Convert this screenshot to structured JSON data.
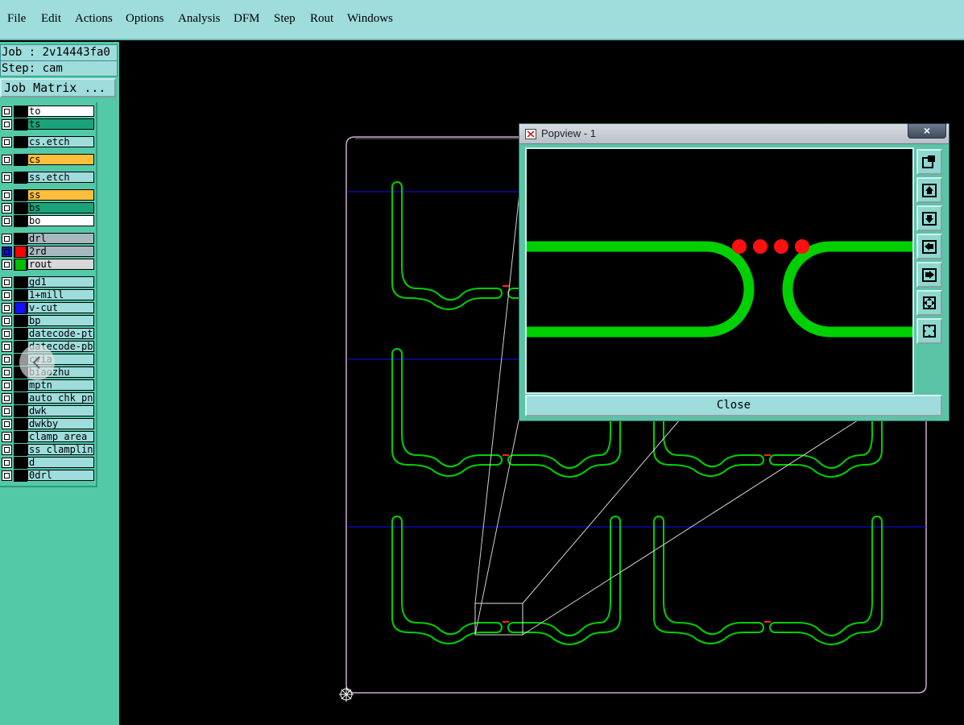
{
  "menu": [
    "File",
    "Edit",
    "Actions",
    "Options",
    "Analysis",
    "DFM",
    "Step",
    "Rout",
    "Windows"
  ],
  "job": {
    "job_line": "Job : 2v14443fa0",
    "step_line": "Step: cam",
    "matrix_button": "Job Matrix ..."
  },
  "layers": [
    {
      "name": "to",
      "bg": "#ffffff",
      "swatch": "#000000",
      "group": 0
    },
    {
      "name": "ts",
      "bg": "#1aa37a",
      "swatch": "#000000",
      "group": 0
    },
    {
      "name": "cs.etch",
      "bg": "#9fdcdc",
      "swatch": "#000000",
      "group": 1
    },
    {
      "name": "cs",
      "bg": "#ffbe3c",
      "swatch": "#000000",
      "group": 2
    },
    {
      "name": "ss.etch",
      "bg": "#9fdcdc",
      "swatch": "#000000",
      "group": 3
    },
    {
      "name": "ss",
      "bg": "#ffbe3c",
      "swatch": "#000000",
      "group": 4
    },
    {
      "name": "bs",
      "bg": "#1aa37a",
      "swatch": "#000000",
      "group": 4
    },
    {
      "name": "bo",
      "bg": "#ffffff",
      "swatch": "#000000",
      "group": 4
    },
    {
      "name": "drl",
      "bg": "#a8b8c0",
      "swatch": "#000000",
      "group": 5
    },
    {
      "name": "2rd",
      "bg": "#a8b8c0",
      "swatch": "#ff0000",
      "group": 5,
      "checked": true
    },
    {
      "name": "rout",
      "bg": "#d8d8d8",
      "swatch": "#00c000",
      "group": 5
    },
    {
      "name": "gd1",
      "bg": "#9fdcdc",
      "swatch": "#000000",
      "group": 6
    },
    {
      "name": "1+mill",
      "bg": "#9fdcdc",
      "swatch": "#000000",
      "group": 6
    },
    {
      "name": "v-cut",
      "bg": "#9fdcdc",
      "swatch": "#1010ff",
      "group": 6
    },
    {
      "name": "bp",
      "bg": "#9fdcdc",
      "swatch": "#000000",
      "group": 6
    },
    {
      "name": "datecode-ptc",
      "bg": "#9fdcdc",
      "swatch": "#000000",
      "group": 6
    },
    {
      "name": "datecode-pbc",
      "bg": "#9fdcdc",
      "swatch": "#000000",
      "group": 6
    },
    {
      "name": "cvia",
      "bg": "#9fdcdc",
      "swatch": "#000000",
      "group": 6
    },
    {
      "name": "biaozhu",
      "bg": "#9fdcdc",
      "swatch": "#000000",
      "group": 6
    },
    {
      "name": "mptn",
      "bg": "#9fdcdc",
      "swatch": "#000000",
      "group": 6
    },
    {
      "name": "auto_chk_pnl",
      "bg": "#9fdcdc",
      "swatch": "#000000",
      "group": 6
    },
    {
      "name": "dwk",
      "bg": "#9fdcdc",
      "swatch": "#000000",
      "group": 6
    },
    {
      "name": "dwkby",
      "bg": "#9fdcdc",
      "swatch": "#000000",
      "group": 6
    },
    {
      "name": "clamp_area",
      "bg": "#9fdcdc",
      "swatch": "#000000",
      "group": 6
    },
    {
      "name": "ss_clampline",
      "bg": "#9fdcdc",
      "swatch": "#000000",
      "group": 6
    },
    {
      "name": "d",
      "bg": "#9fdcdc",
      "swatch": "#000000",
      "group": 6
    },
    {
      "name": "0drl",
      "bg": "#9fdcdc",
      "swatch": "#000000",
      "group": 6
    }
  ],
  "popview": {
    "title": "Popview - 1",
    "close_x": "×",
    "close_button": "Close"
  },
  "colors": {
    "menubar": "#9fdcdc",
    "panel": "#54c9a8",
    "rout": "#00d000",
    "vcut": "#1010ff",
    "pad": "#ff1010"
  },
  "icons": [
    "zoom-fit-icon",
    "move-up-icon",
    "move-down-icon",
    "move-left-icon",
    "move-right-icon",
    "zoom-in-icon",
    "zoom-out-icon"
  ]
}
